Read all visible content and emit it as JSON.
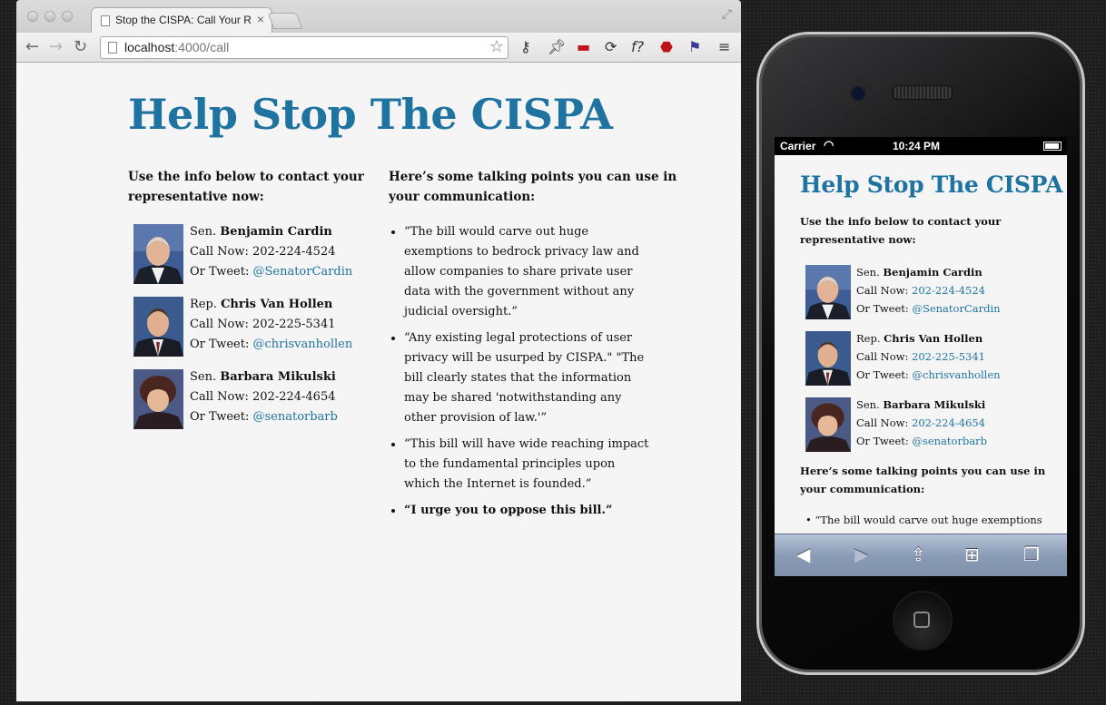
{
  "browser": {
    "tab_title": "Stop the CISPA: Call Your R",
    "tab_close": "×",
    "url_host": "localhost",
    "url_rest": ":4000/call",
    "extensions": [
      "key-icon",
      "pin-icon",
      "couch-icon",
      "sync-icon",
      "function-icon",
      "stop-icon",
      "flag-icon",
      "menu-icon"
    ]
  },
  "page": {
    "title": "Help Stop The CISPA",
    "contact_intro_line1": "Use the info below to contact your",
    "contact_intro_line2": "representative now:",
    "talking_intro_line1": "Here’s some talking points you can use in",
    "talking_intro_line2": "your communication:",
    "call_label": "Call Now:",
    "tweet_label": "Or Tweet:",
    "reps": [
      {
        "title": "Sen.",
        "name": "Benjamin Cardin",
        "phone": "202-224-4524",
        "twitter": "@SenatorCardin"
      },
      {
        "title": "Rep.",
        "name": "Chris Van Hollen",
        "phone": "202-225-5341",
        "twitter": "@chrisvanhollen"
      },
      {
        "title": "Sen.",
        "name": "Barbara Mikulski",
        "phone": "202-224-4654",
        "twitter": "@senatorbarb"
      }
    ],
    "points": [
      "“The bill would carve out huge exemptions to bedrock privacy law and allow companies to share private user data with the government without any judicial oversight.”",
      "“Any existing legal protections of user privacy will be usurped by CISPA.\" \"The bill clearly states that the information may be shared 'notwithstanding any other provision of law.'”",
      "“This bill will have wide reaching impact to the fundamental principles upon which the Internet is founded.”",
      "“I urge you to oppose this bill.”"
    ]
  },
  "phone": {
    "carrier": "Carrier",
    "time": "10:24 PM",
    "title": "Help Stop The CISPA",
    "contact_intro_line1": "Use the info below to contact your",
    "contact_intro_line2": "representative now:",
    "talking_intro_line1": "Here’s some talking points you can use in",
    "talking_intro_line2": "your communication:",
    "first_point_preview": "“The bill would carve out huge exemptions"
  },
  "colors": {
    "accent": "#1f73a0",
    "page_bg": "#f5f5f5"
  }
}
